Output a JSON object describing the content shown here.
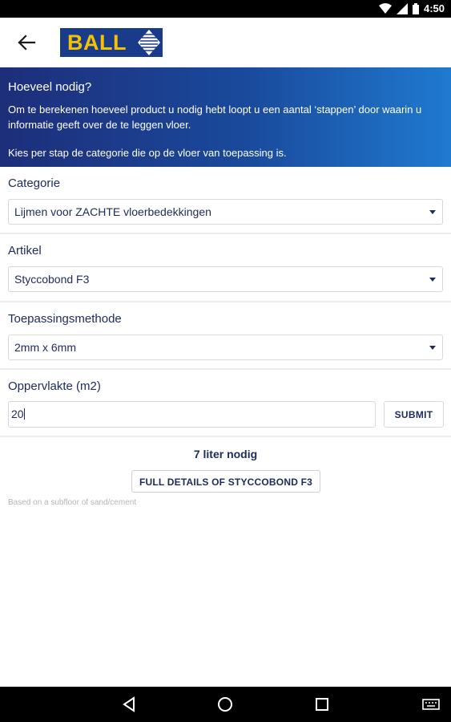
{
  "status_bar": {
    "time": "4:50"
  },
  "app": {
    "logo_text": "BALL"
  },
  "intro": {
    "title": "Hoeveel nodig?",
    "paragraph1": "Om te berekenen hoeveel product u nodig hebt loopt u een aantal ‘stappen’ door waarin u informatie geeft over de te leggen vloer.",
    "paragraph2": "Kies per stap de categorie die op de vloer van toepassing is."
  },
  "form": {
    "categorie": {
      "label": "Categorie",
      "value": "Lijmen voor ZACHTE vloerbedekkingen"
    },
    "artikel": {
      "label": "Artikel",
      "value": "Styccobond F3"
    },
    "methode": {
      "label": "Toepassingsmethode",
      "value": "2mm x 6mm"
    },
    "oppervlakte": {
      "label": "Oppervlakte (m2)",
      "value": "20"
    },
    "submit_label": "SUBMIT"
  },
  "result": {
    "text": "7 liter nodig",
    "details_label": "FULL DETAILS OF STYCCOBOND F3",
    "note": "Based on a subfloor of sand/cement"
  },
  "colors": {
    "brand_blue": "#1a3a8a",
    "logo_yellow": "#f3c200",
    "text_navy": "#1d2a5c"
  },
  "icons": [
    "wifi-icon",
    "signal-icon",
    "battery-icon",
    "back-arrow-icon",
    "nav-back-icon",
    "nav-home-icon",
    "nav-recents-icon",
    "keyboard-icon"
  ]
}
